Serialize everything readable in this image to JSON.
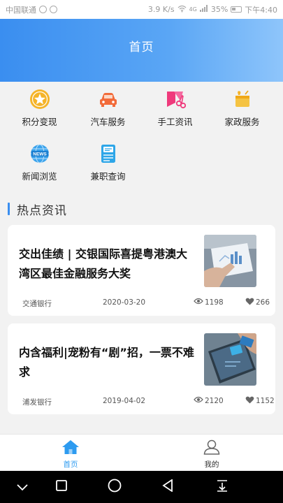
{
  "status_bar": {
    "carrier": "中国联通",
    "speed": "3.9 K/s",
    "signal": "4G",
    "battery": "35%",
    "time": "下午4:40"
  },
  "header": {
    "title": "首页"
  },
  "grid": [
    {
      "label": "积分变现",
      "icon": "points-star-icon"
    },
    {
      "label": "汽车服务",
      "icon": "car-icon"
    },
    {
      "label": "手工资讯",
      "icon": "scissors-icon"
    },
    {
      "label": "家政服务",
      "icon": "housekeeping-icon"
    },
    {
      "label": "新闻浏览",
      "icon": "news-globe-icon"
    },
    {
      "label": "兼职查询",
      "icon": "parttime-doc-icon"
    }
  ],
  "section": {
    "title": "热点资讯"
  },
  "articles": [
    {
      "title": "交出佳绩 | 交银国际喜提粤港澳大湾区最佳金融服务大奖",
      "source": "交通银行",
      "date": "2020-03-20",
      "views": "1198",
      "likes": "266"
    },
    {
      "title": "内含福利|宠粉有“剧”招，一票不难求",
      "source": "浦发银行",
      "date": "2019-04-02",
      "views": "2120",
      "likes": "1152"
    }
  ],
  "tabbar": {
    "home_label": "首页",
    "mine_label": "我的",
    "active_color": "#2d9bf0"
  }
}
